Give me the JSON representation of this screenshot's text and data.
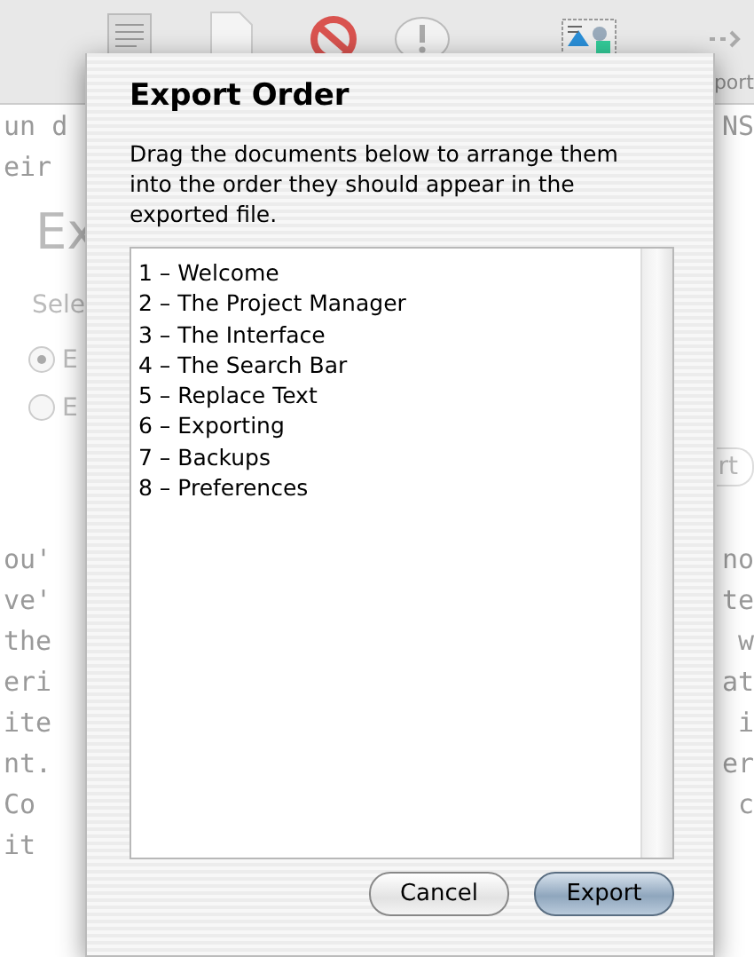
{
  "background_window": {
    "toolbar": {
      "label": "port"
    },
    "rows": [
      {
        "left": "un d",
        "right": "NS"
      },
      {
        "left": "eir"
      }
    ],
    "heading": "Ex",
    "section_label": "Sele",
    "radios": [
      {
        "label": "E",
        "selected": true
      },
      {
        "label": "E",
        "selected": false
      }
    ],
    "button": "rt",
    "text_lines": [
      {
        "left": "ou'",
        "right": "no"
      },
      {
        "left": "ve'",
        "right": "te"
      },
      {
        "left": "the",
        "right": "w"
      },
      {
        "left": "eri",
        "right": "at"
      },
      {
        "left": "ite",
        "right": "i"
      },
      {
        "left": "nt.",
        "right": "er"
      },
      {
        "left": "Co",
        "right": "c"
      },
      {
        "left": "it"
      }
    ]
  },
  "sheet": {
    "title": "Export Order",
    "description": "Drag the documents below to arrange them into the order they should appear in the exported file.",
    "documents": [
      "1 – Welcome",
      "2 – The Project Manager",
      "3 – The Interface",
      "4 – The Search Bar",
      "5 – Replace Text",
      "6 – Exporting",
      "7 – Backups",
      "8 – Preferences"
    ],
    "buttons": [
      {
        "label": "Cancel",
        "default": false
      },
      {
        "label": "Export",
        "default": true
      }
    ]
  }
}
